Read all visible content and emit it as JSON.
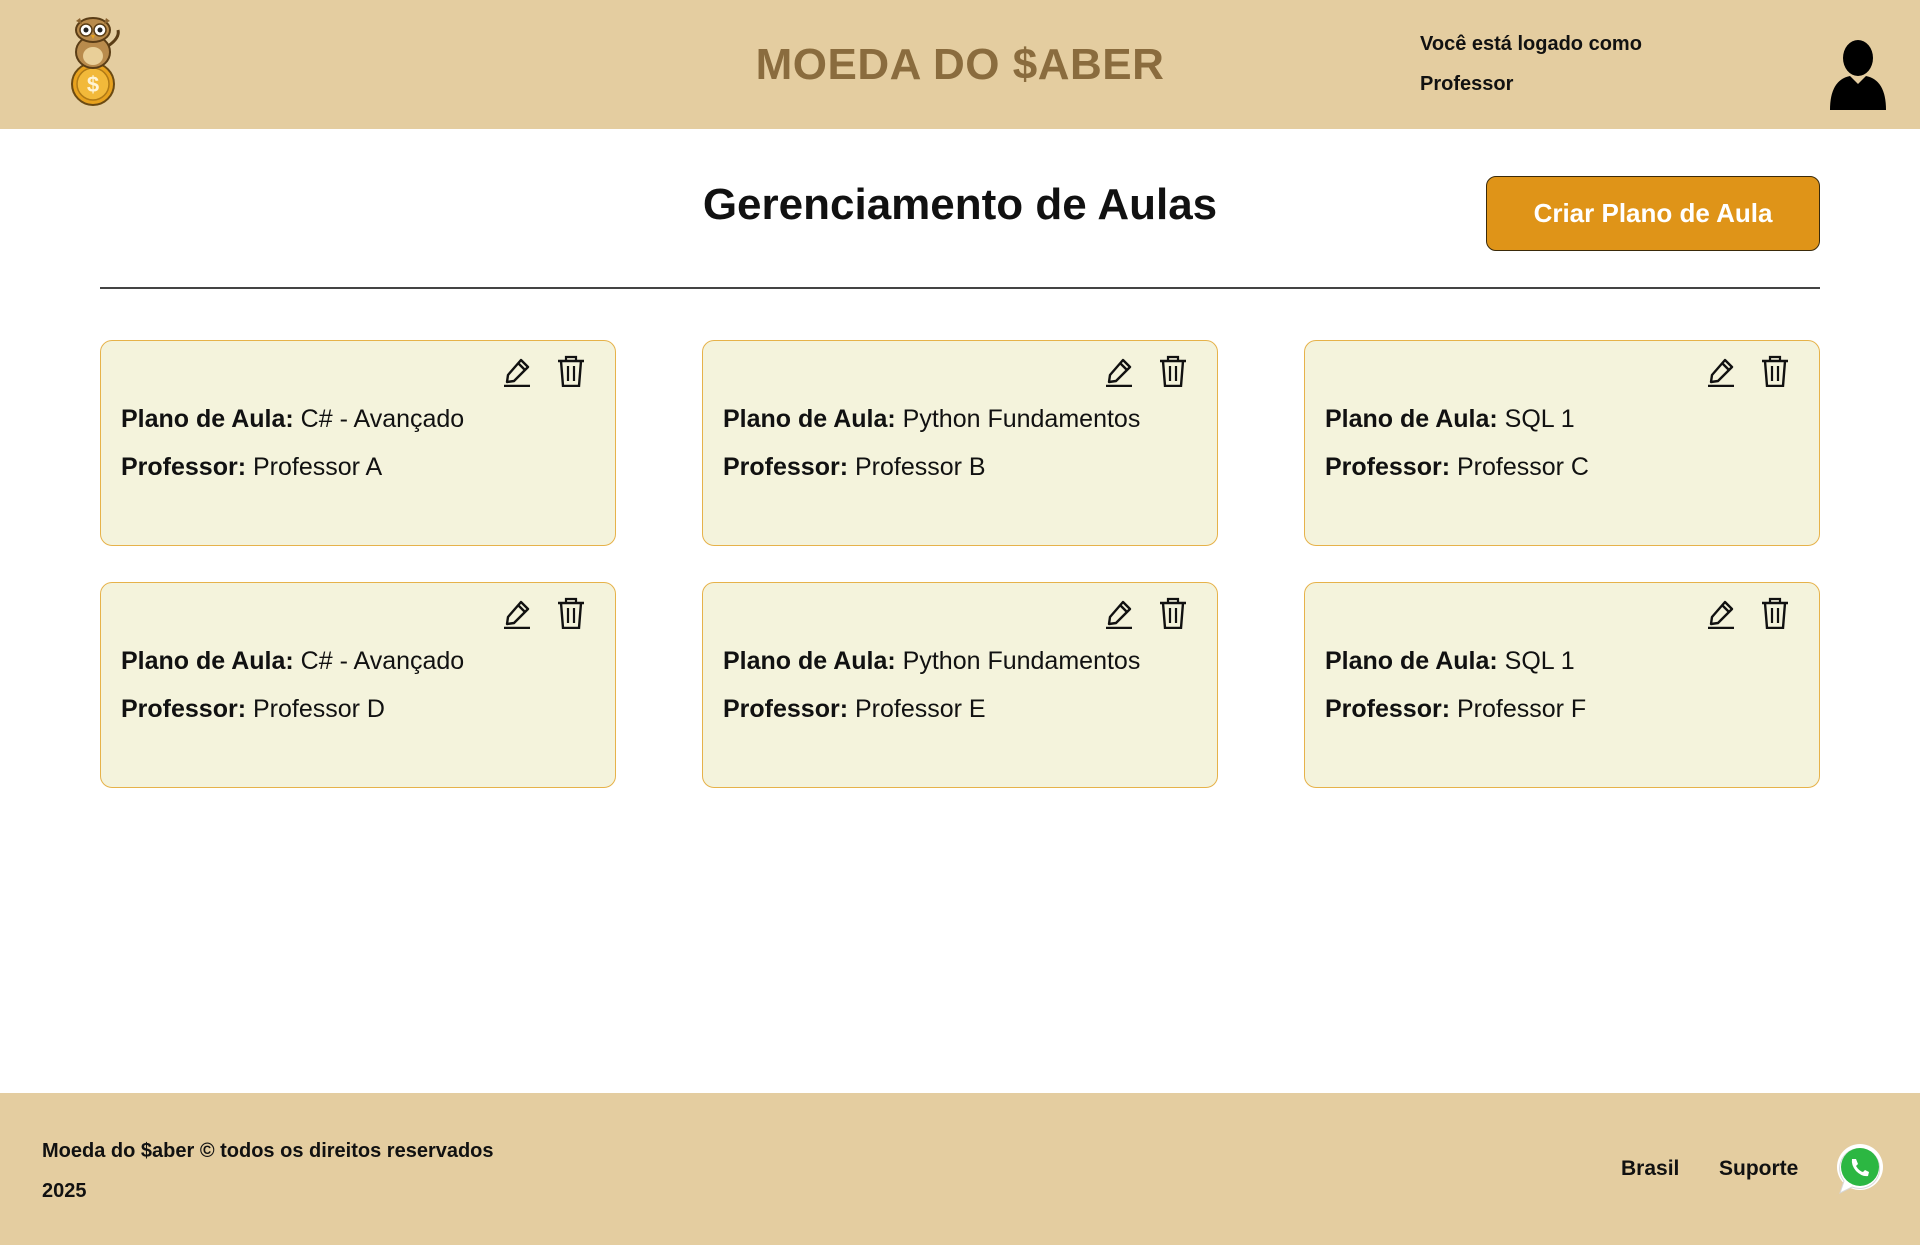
{
  "header": {
    "app_title": "MOEDA DO $ABER",
    "login_line1": "Você está logado como",
    "login_line2": "Professor",
    "logo_icon": "owl-coin-logo-icon",
    "avatar_icon": "user-silhouette-icon"
  },
  "main": {
    "page_title": "Gerenciamento de Aulas",
    "create_button_label": "Criar Plano de Aula",
    "plan_label": "Plano de Aula:",
    "teacher_label": "Professor:",
    "edit_icon": "pencil-icon",
    "delete_icon": "trash-icon",
    "cards": [
      {
        "plan": "C# - Avançado",
        "teacher": "Professor A"
      },
      {
        "plan": "Python Fundamentos",
        "teacher": "Professor B"
      },
      {
        "plan": "SQL 1",
        "teacher": "Professor C"
      },
      {
        "plan": "C# - Avançado",
        "teacher": "Professor D"
      },
      {
        "plan": "Python Fundamentos",
        "teacher": "Professor E"
      },
      {
        "plan": "SQL 1",
        "teacher": "Professor F"
      }
    ]
  },
  "footer": {
    "copyright_line1": "Moeda do $aber © todos os direitos reservados",
    "copyright_line2": "2025",
    "link_brasil": "Brasil",
    "link_suporte": "Suporte",
    "whatsapp_icon": "whatsapp-icon"
  },
  "colors": {
    "header_bg": "#e4cda0",
    "title_color": "#8a6c3e",
    "accent": "#df9418",
    "card_bg": "#f4f3dc",
    "card_border": "#e6b24a"
  }
}
